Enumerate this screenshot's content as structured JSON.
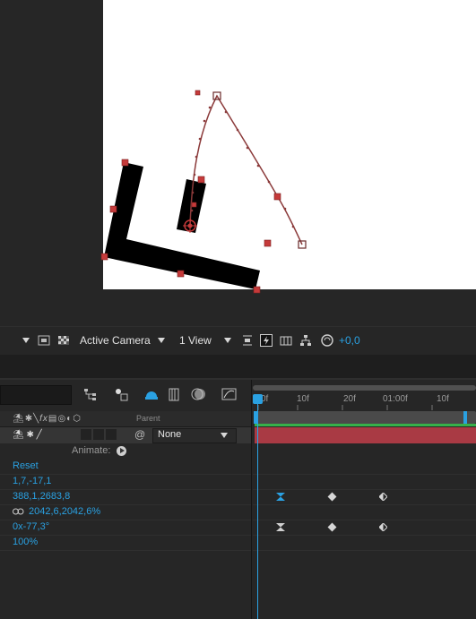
{
  "viewer": {
    "camera_label": "Active Camera",
    "view_label": "1 View",
    "exposure_value": "+0,0"
  },
  "timeline": {
    "columns": {
      "parent_label": "Parent"
    },
    "layer": {
      "parent_value": "None"
    },
    "animate_label": "Animate:",
    "properties": [
      {
        "label": "Reset",
        "keyframes": []
      },
      {
        "label": "1,7,-17,1",
        "keyframes": []
      },
      {
        "label": "388,1,2683,8",
        "keyframes": []
      },
      {
        "label": "2042,6,2042,6%",
        "keyframes": []
      },
      {
        "label": "0x-77,3°",
        "keyframes": []
      },
      {
        "label": "100%",
        "keyframes": []
      }
    ],
    "ruler_ticks": [
      "0f",
      "10f",
      "20f",
      "01:00f",
      "10f"
    ]
  },
  "colors": {
    "accent": "#2aa1e2",
    "layer_bar": "#a93a44",
    "work_area_green": "#36b04a",
    "motion_path": "#8b3a3a"
  }
}
